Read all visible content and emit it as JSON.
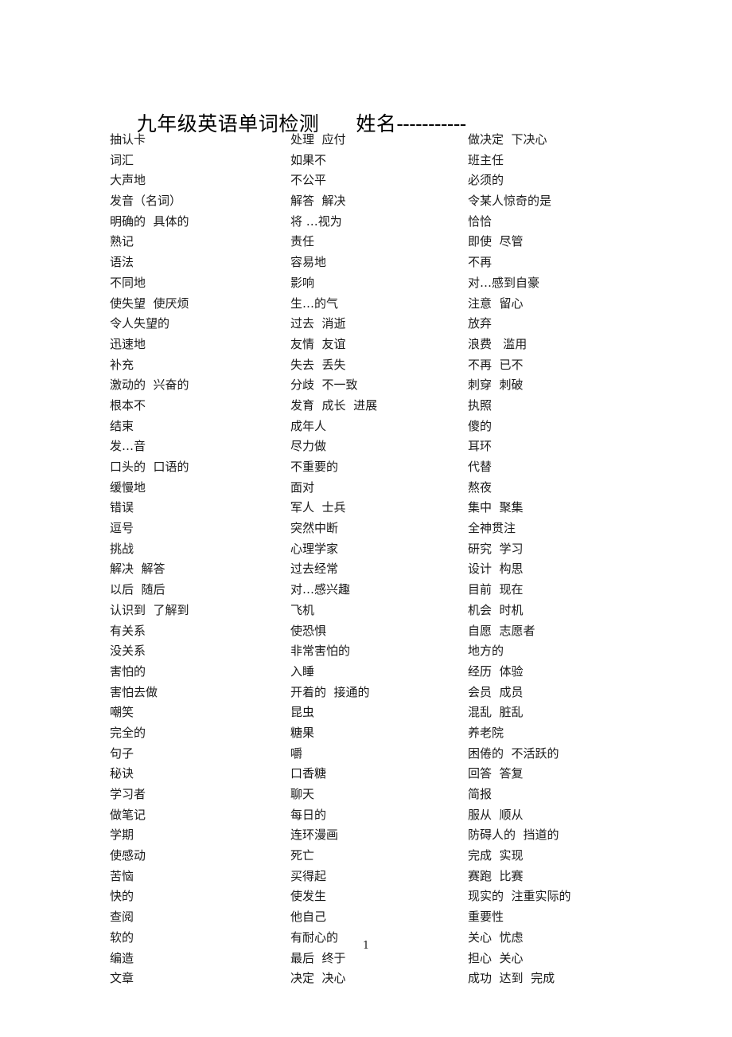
{
  "document": {
    "title_main": "九年级英语单词检测",
    "title_name_label": "姓名",
    "title_dashes": "-----------",
    "page_number": "1"
  },
  "columns": [
    {
      "name": "column-1",
      "rows": [
        "抽认卡",
        "词汇",
        "大声地",
        "发音（名词）",
        "明确的  具体的",
        "熟记",
        "语法",
        "不同地",
        "使失望  使厌烦",
        "令人失望的",
        "迅速地",
        "补充",
        "激动的  兴奋的",
        "根本不",
        "结束",
        "发…音",
        "口头的  口语的",
        "缓慢地",
        "错误",
        "逗号",
        "挑战",
        "解决  解答",
        "以后  随后",
        "认识到  了解到",
        "有关系",
        "没关系",
        "害怕的",
        "害怕去做",
        "嘲笑",
        "完全的",
        "句子",
        "秘诀",
        "学习者",
        "做笔记",
        "学期",
        "使感动",
        "苦恼",
        "快的",
        "查阅",
        "软的",
        "编造",
        "文章"
      ]
    },
    {
      "name": "column-2",
      "rows": [
        "处理  应付",
        "如果不",
        "不公平",
        "解答  解决",
        "将 …视为",
        "责任",
        "容易地",
        "影响",
        "生…的气",
        "过去  消逝",
        "友情  友谊",
        "失去  丢失",
        "分歧  不一致",
        "发育  成长  进展",
        "成年人",
        "尽力做",
        "不重要的",
        "面对",
        "军人  士兵",
        "突然中断",
        "心理学家",
        "过去经常",
        "对…感兴趣",
        "飞机",
        "使恐惧",
        "非常害怕的",
        "入睡",
        "开着的  接通的",
        "昆虫",
        "糖果",
        "嚼",
        "口香糖",
        "聊天",
        "每日的",
        "连环漫画",
        "死亡",
        "买得起",
        "使发生",
        "他自己",
        "有耐心的",
        "最后  终于",
        "决定  决心"
      ]
    },
    {
      "name": "column-3",
      "rows": [
        "做决定  下决心",
        "班主任",
        "必须的",
        "令某人惊奇的是",
        "恰恰",
        "即使  尽管",
        "不再",
        "对…感到自豪",
        "注意  留心",
        "放弃",
        "浪费   滥用",
        "不再  已不",
        "刺穿  刺破",
        "执照",
        "傻的",
        "耳环",
        "代替",
        "熬夜",
        "集中  聚集",
        "全神贯注",
        "研究  学习",
        "设计  构思",
        "目前  现在",
        "机会  时机",
        "自愿  志愿者",
        "地方的",
        "经历  体验",
        "会员  成员",
        "混乱  脏乱",
        "养老院",
        "困倦的  不活跃的",
        "回答  答复",
        "简报",
        "服从  顺从",
        "防碍人的  挡道的",
        "完成  实现",
        "赛跑  比赛",
        "现实的  注重实际的",
        "重要性",
        "关心  忧虑",
        "担心  关心",
        "成功  达到  完成"
      ]
    }
  ]
}
